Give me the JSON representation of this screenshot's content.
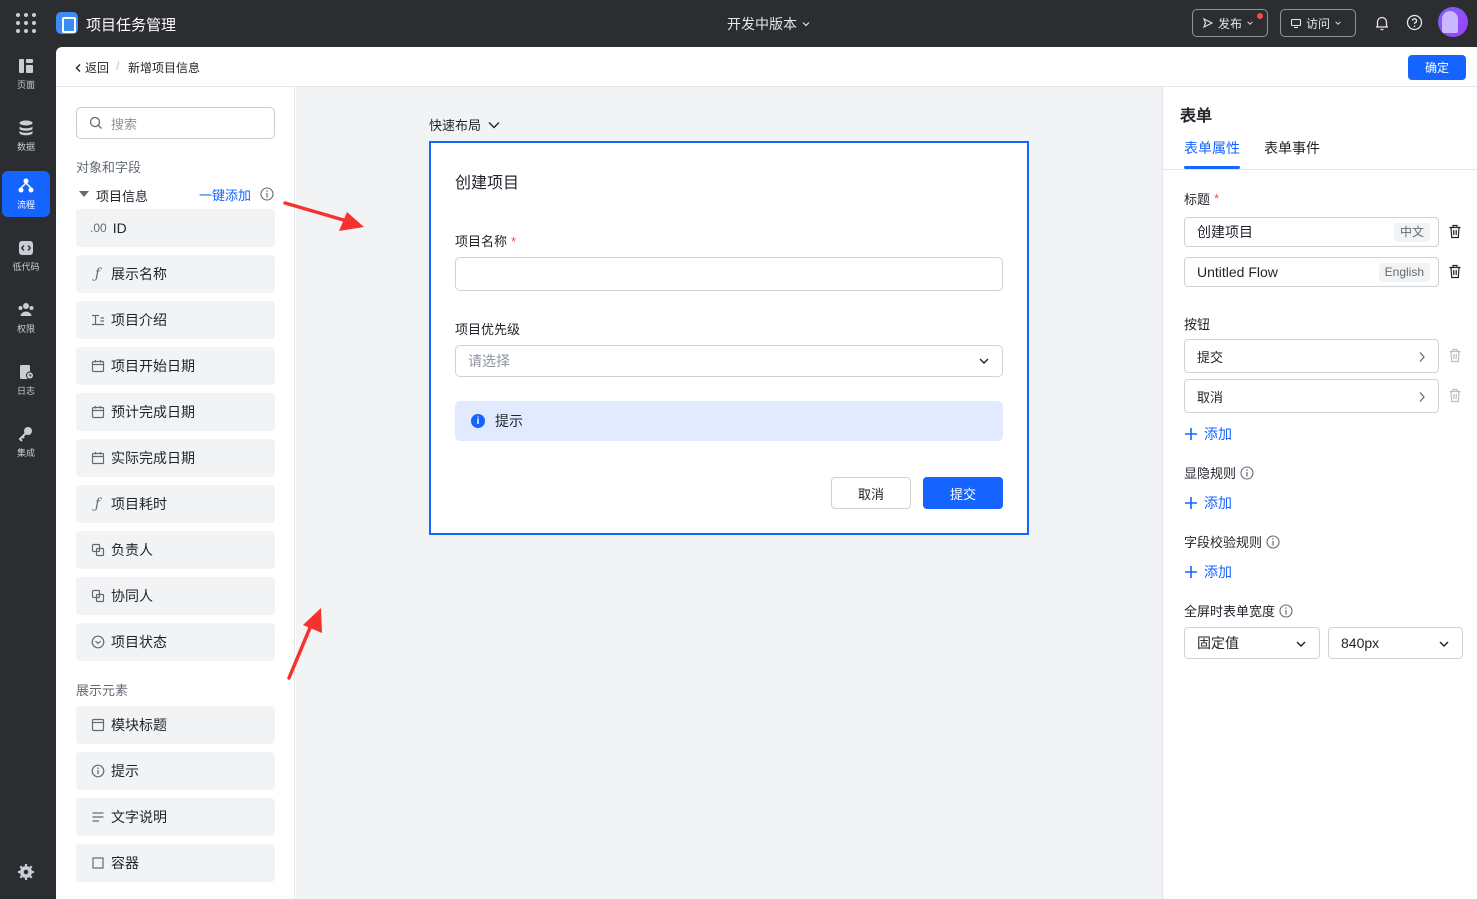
{
  "topbar": {
    "app_title": "项目任务管理",
    "version": "开发中版本",
    "publish_label": "发布",
    "visit_label": "访问"
  },
  "rail": {
    "items": [
      {
        "label": "页面",
        "icon": "page-icon"
      },
      {
        "label": "数据",
        "icon": "database-icon"
      },
      {
        "label": "流程",
        "icon": "flow-icon",
        "active": true
      },
      {
        "label": "低代码",
        "icon": "code-icon"
      },
      {
        "label": "权限",
        "icon": "users-icon"
      },
      {
        "label": "日志",
        "icon": "log-icon"
      },
      {
        "label": "集成",
        "icon": "integration-icon"
      }
    ]
  },
  "header": {
    "back_label": "返回",
    "separator": "/",
    "title": "新增项目信息",
    "confirm_label": "确定"
  },
  "fields_panel": {
    "search_placeholder": "搜索",
    "section_objects": "对象和字段",
    "group_name": "项目信息",
    "add_all_label": "一键添加",
    "field_items": [
      {
        "label": "ID",
        "icon_text": ".00",
        "icon": "number-icon"
      },
      {
        "label": "展示名称",
        "icon_text": "ƒ",
        "icon": "formula-icon"
      },
      {
        "label": "项目介绍",
        "icon_text": "",
        "icon": "text-icon"
      },
      {
        "label": "项目开始日期",
        "icon_text": "",
        "icon": "calendar-icon"
      },
      {
        "label": "预计完成日期",
        "icon_text": "",
        "icon": "calendar-icon"
      },
      {
        "label": "实际完成日期",
        "icon_text": "",
        "icon": "calendar-icon"
      },
      {
        "label": "项目耗时",
        "icon_text": "ƒ",
        "icon": "formula-icon"
      },
      {
        "label": "负责人",
        "icon_text": "",
        "icon": "lookup-icon"
      },
      {
        "label": "协同人",
        "icon_text": "",
        "icon": "lookup-icon"
      },
      {
        "label": "项目状态",
        "icon_text": "",
        "icon": "option-icon"
      }
    ],
    "section_display": "展示元素",
    "display_items": [
      {
        "label": "模块标题",
        "icon": "title-block-icon"
      },
      {
        "label": "提示",
        "icon": "info-icon"
      },
      {
        "label": "文字说明",
        "icon": "lines-icon"
      },
      {
        "label": "容器",
        "icon": "container-icon"
      }
    ]
  },
  "canvas": {
    "quick_layout": "快速布局",
    "form": {
      "title": "创建项目",
      "name_label": "项目名称",
      "name_required": "*",
      "name_value": "",
      "priority_label": "项目优先级",
      "priority_placeholder": "请选择",
      "tip_text": "提示",
      "cancel_label": "取消",
      "submit_label": "提交"
    }
  },
  "props": {
    "title": "表单",
    "tabs": [
      "表单属性",
      "表单事件"
    ],
    "title_label": "标题",
    "title_required": "*",
    "title_zh_value": "创建项目",
    "title_zh_tag": "中文",
    "title_en_value": "Untitled Flow",
    "title_en_tag": "English",
    "buttons_label": "按钮",
    "buttons": [
      "提交",
      "取消"
    ],
    "add_label": "添加",
    "visibility_label": "显隐规则",
    "validation_label": "字段校验规则",
    "fullscreen_width_label": "全屏时表单宽度",
    "width_mode": "固定值",
    "width_value": "840px"
  },
  "colors": {
    "accent": "#1664ff",
    "annotation_arrow": "#f5322d",
    "topbar_bg": "#2b2d30"
  }
}
